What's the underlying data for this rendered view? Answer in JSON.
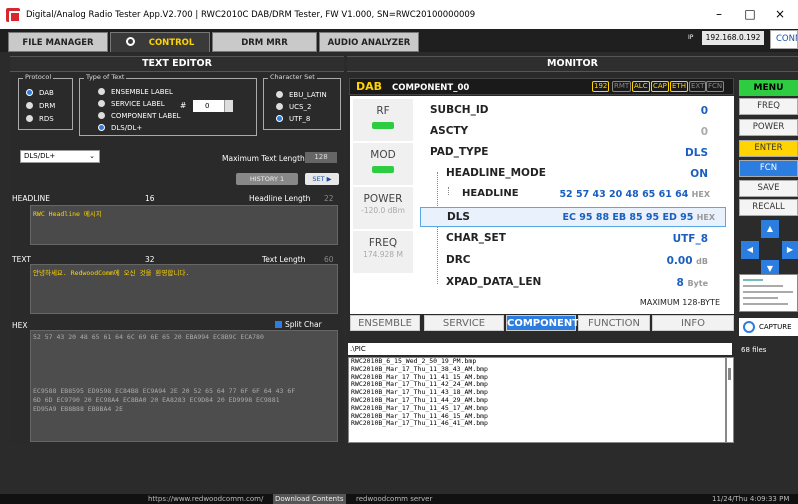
{
  "window": {
    "title": "Digital/Analog Radio Tester App.V2.700 | RWC2010C DAB/DRM Tester, FW V1.000, SN=RWC20100000009",
    "minimize": "–",
    "maximize": "□",
    "close": "×"
  },
  "tabs": [
    {
      "label": "FILE MANAGER"
    },
    {
      "label": "CONTROL"
    },
    {
      "label": "DRM MRR"
    },
    {
      "label": "AUDIO ANALYZER"
    }
  ],
  "ip": {
    "label": "IP",
    "value": "192.168.0.192"
  },
  "connection": "CONNECTED",
  "editor": {
    "header": "TEXT EDITOR",
    "protocol": {
      "label": "Protocol",
      "options": [
        "DAB",
        "DRM",
        "RDS"
      ],
      "selected": "DAB"
    },
    "type_of_text": {
      "label": "Type of Text",
      "options": [
        "ENSEMBLE LABEL",
        "SERVICE LABEL",
        "COMPONENT LABEL",
        "DLS/DL+"
      ],
      "selected": "DLS/DL+",
      "hash": "#",
      "spin_value": "0"
    },
    "charset": {
      "label": "Character Set",
      "options": [
        "EBU_LATIN",
        "UCS_2",
        "UTF_8"
      ],
      "selected": "UTF_8"
    },
    "combo": "DLS/DL+",
    "max_len_label": "Maximum Text Length",
    "max_len": "128",
    "history_button": "HISTORY 1",
    "set_button": "SET ▶",
    "headline": {
      "label": "HEADLINE",
      "count": "16",
      "len_label": "Headline Length",
      "len_value": "22",
      "text": "RWC Headline 메시지"
    },
    "text": {
      "label": "TEXT",
      "count": "32",
      "len_label": "Text Length",
      "len_value": "60",
      "text": "안녕하세요. RedwoodComm에 오신 것을 환영합니다."
    },
    "hex": {
      "label": "HEX",
      "split_label": "Split Char",
      "line1": "52 57 43 20 48 65 61 64 6C 69 6E 65 20 EBA994 EC8B9C ECA780",
      "line2": "EC9588 EB8595 ED9598 EC84B8 EC9A94 2E 20 52 65 64 77 6F 6F 64 43 6F",
      "line3": "6D 6D EC9790 20 EC98A4 EC8BA0 20 EA8283 EC9D84 20 ED9998 EC9881",
      "line4": "ED95A9 EB8B88 EB8BA4 2E"
    }
  },
  "monitor": {
    "header": "MONITOR",
    "dab": "DAB",
    "component": "COMPONENT_00",
    "badges": [
      "192",
      "RMT",
      "ALC",
      "CAP",
      "ETH",
      "EXT",
      "FCN"
    ],
    "side": [
      {
        "label": "RF",
        "value": ""
      },
      {
        "label": "MOD",
        "value": ""
      },
      {
        "label": "POWER",
        "value": "-120.0 dBm"
      },
      {
        "label": "FREQ",
        "value": "174.928 M"
      }
    ],
    "rows": [
      {
        "key": "SUBCH_ID",
        "value": "0"
      },
      {
        "key": "ASCTY",
        "value": "0"
      },
      {
        "key": "PAD_TYPE",
        "value": "DLS"
      },
      {
        "key": "HEADLINE_MODE",
        "value": "ON"
      },
      {
        "key": "HEADLINE",
        "value": "52 57 43 20 48 65 61 64",
        "unit": "HEX"
      },
      {
        "key": "DLS",
        "value": "EC 95 88 EB 85 95 ED 95",
        "unit": "HEX"
      },
      {
        "key": "CHAR_SET",
        "value": "UTF_8"
      },
      {
        "key": "DRC",
        "value": "0.00",
        "unit": "dB"
      },
      {
        "key": "XPAD_DATA_LEN",
        "value": "8",
        "unit": "Byte"
      }
    ],
    "max_bytes": "MAXIMUM 128-BYTE",
    "bottom_tabs": [
      "ENSEMBLE",
      "SERVICE",
      "COMPONENT",
      "FUNCTION",
      "INFO"
    ]
  },
  "files": {
    "path": ".\\PIC",
    "count": "68 files",
    "list": [
      "RWC2010B_6_15_Wed_2_50_19_PM.bmp",
      "RWC2010B_Mar_17_Thu_11_38_43_AM.bmp",
      "RWC2010B_Mar_17_Thu_11_41_15_AM.bmp",
      "RWC2010B_Mar_17_Thu_11_42_24_AM.bmp",
      "RWC2010B_Mar_17_Thu_11_43_18_AM.bmp",
      "RWC2010B_Mar_17_Thu_11_44_29_AM.bmp",
      "RWC2010B_Mar_17_Thu_11_45_17_AM.bmp",
      "RWC2010B_Mar_17_Thu_11_46_15_AM.bmp",
      "RWC2010B_Mar_17_Thu_11_46_41_AM.bmp"
    ]
  },
  "menu": {
    "header": "MENU",
    "buttons": [
      "FREQ",
      "POWER",
      "ENTER",
      "FCN",
      "SAVE",
      "RECALL"
    ],
    "capture": "CAPTURE"
  },
  "status": {
    "url": "https://www.redwoodcomm.com/",
    "download": "Download Contents",
    "server": "redwoodcomm server",
    "datetime": "11/24/Thu 4:09:33 PM"
  }
}
